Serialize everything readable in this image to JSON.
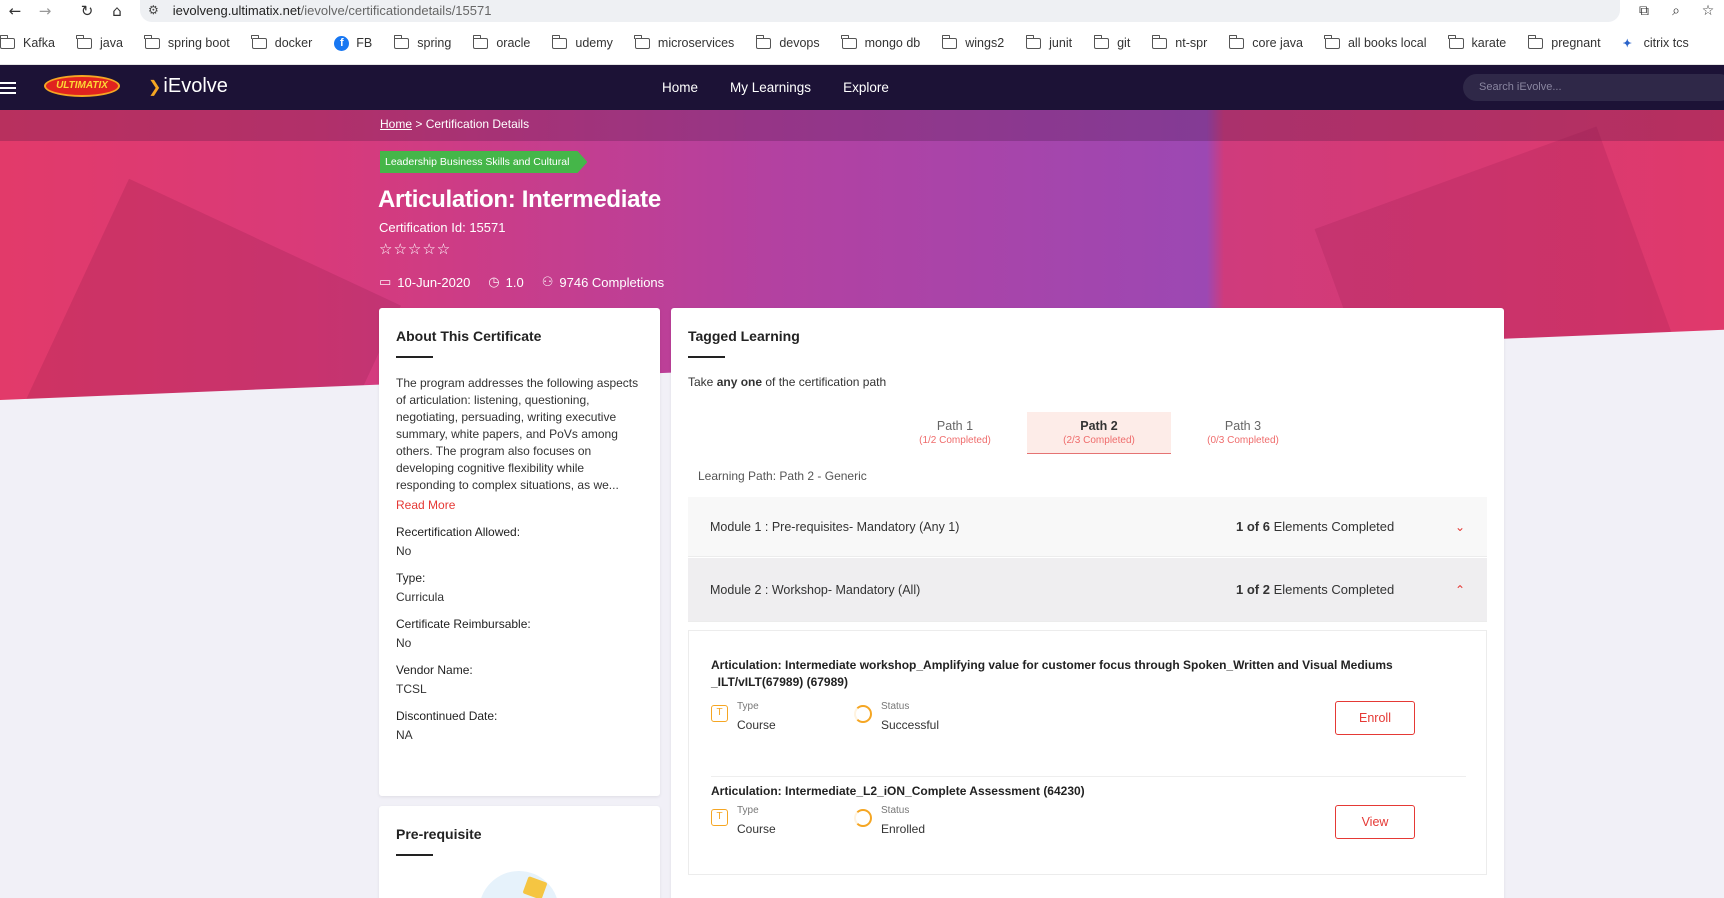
{
  "browser": {
    "url_host": "ievolveng.ultimatix.net",
    "url_path": "/ievolve/certificationdetails/15571",
    "bookmarks": [
      "Kafka",
      "java",
      "spring boot",
      "docker",
      "FB",
      "spring",
      "oracle",
      "udemy",
      "microservices",
      "devops",
      "mongo db",
      "wings2",
      "junit",
      "git",
      "nt-spr",
      "core java",
      "all books local",
      "karate",
      "pregnant",
      "citrix tcs"
    ]
  },
  "header": {
    "logo_ultimatix": "ULTIMATIX",
    "logo_ievolve": "iEvolve",
    "nav": [
      "Home",
      "My Learnings",
      "Explore"
    ],
    "search_placeholder": "Search iEvolve..."
  },
  "hero": {
    "breadcrumb_home": "Home",
    "breadcrumb_sep": " > ",
    "breadcrumb_current": "Certification Details",
    "category": "Leadership Business Skills and Cultural",
    "title": "Articulation: Intermediate",
    "cert_id": "Certification Id: 15571",
    "rating": 0,
    "date": "10-Jun-2020",
    "version": "1.0",
    "completions": "9746 Completions"
  },
  "about": {
    "heading": "About This Certificate",
    "description": "The program addresses the following aspects of articulation: listening, questioning, negotiating, persuading, writing executive summary, white papers, and PoVs among others. The program also focuses on developing cognitive flexibility while responding to complex situations, as we...",
    "read_more": "Read More",
    "fields": [
      {
        "label": "Recertification Allowed:",
        "value": "No"
      },
      {
        "label": "Type:",
        "value": "Curricula"
      },
      {
        "label": "Certificate Reimbursable:",
        "value": "No"
      },
      {
        "label": "Vendor Name:",
        "value": "TCSL"
      },
      {
        "label": "Discontinued Date:",
        "value": "NA"
      }
    ]
  },
  "prereq": {
    "heading": "Pre-requisite"
  },
  "tagged": {
    "heading": "Tagged Learning",
    "take_prefix": "Take ",
    "take_bold": "any one",
    "take_suffix": " of the certification path",
    "paths": [
      {
        "name": "Path 1",
        "progress": "(1/2 Completed)",
        "active": false
      },
      {
        "name": "Path 2",
        "progress": "(2/3 Completed)",
        "active": true
      },
      {
        "name": "Path 3",
        "progress": "(0/3 Completed)",
        "active": false
      }
    ],
    "learning_path": "Learning Path: Path 2 - Generic",
    "modules": [
      {
        "name": "Module 1 : Pre-requisites- Mandatory (Any 1)",
        "count": "1 of 6",
        "suffix": " Elements Completed",
        "expanded": false
      },
      {
        "name": "Module 2 : Workshop- Mandatory (All)",
        "count": "1 of 2",
        "suffix": " Elements Completed",
        "expanded": true
      }
    ],
    "items": [
      {
        "name": "Articulation: Intermediate workshop_Amplifying value for customer focus through Spoken_Written and Visual Mediums _ILT/vILT(67989) (67989)",
        "type_label": "Type",
        "type": "Course",
        "status_label": "Status",
        "status": "Successful",
        "button": "Enroll"
      },
      {
        "name": "Articulation: Intermediate_L2_iON_Complete Assessment (64230)",
        "type_label": "Type",
        "type": "Course",
        "status_label": "Status",
        "status": "Enrolled",
        "button": "View"
      }
    ]
  }
}
